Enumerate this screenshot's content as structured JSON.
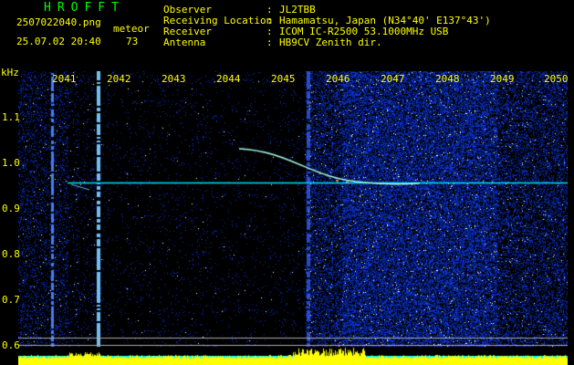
{
  "app": {
    "logo": "HROFFT",
    "filename": "2507022040.png",
    "datetime": "25.07.02 20:40",
    "mode_label": "meteor",
    "count": "73"
  },
  "info": {
    "rows": [
      {
        "label": "Observer",
        "sep": ":",
        "value": "JL2TBB"
      },
      {
        "label": "Receiving Location",
        "sep": ":",
        "value": "Hamamatsu, Japan (N34°40' E137°43')"
      },
      {
        "label": "Receiver",
        "sep": ":",
        "value": "ICOM IC-R2500 53.1000MHz USB"
      },
      {
        "label": "Antenna",
        "sep": ":",
        "value": "HB9CV Zenith dir."
      }
    ]
  },
  "axis": {
    "y_unit": "kHz",
    "x_ticks": [
      "2041",
      "2042",
      "2043",
      "2044",
      "2045",
      "2046",
      "2047",
      "2048",
      "2049",
      "2050"
    ],
    "y_ticks": [
      "1.1",
      "1.0",
      "0.9",
      "0.8",
      "0.7",
      "0.6"
    ]
  },
  "colors": {
    "background": "#000000",
    "label": "#ffff00",
    "logo": "#00ff00",
    "noise": "#1a3cff",
    "carrier": "#00e0ff",
    "trace": "#a0ffe0",
    "baseline": "#00ffff"
  }
}
